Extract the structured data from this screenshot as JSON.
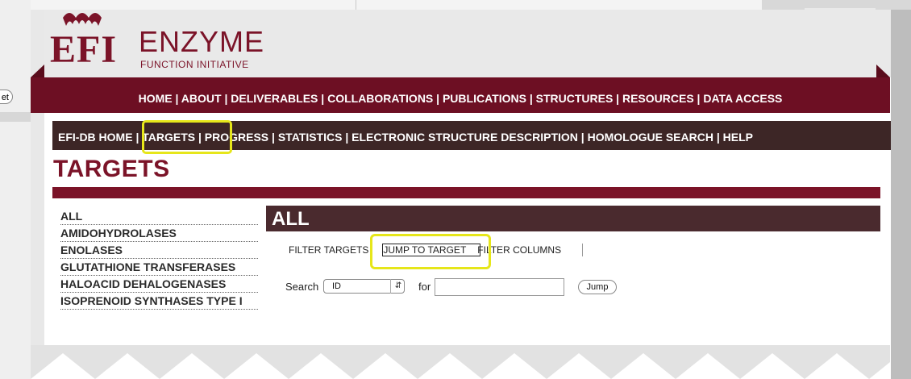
{
  "left_stub_button": "et",
  "logo": {
    "efi": "EFI",
    "name": "ENZYME",
    "subtitle": "FUNCTION INITIATIVE"
  },
  "main_nav": "HOME | ABOUT | DELIVERABLES | COLLABORATIONS | PUBLICATIONS | STRUCTURES | RESOURCES | DATA ACCESS",
  "sub_nav": "EFI-DB HOME | TARGETS | PROGRESS | STATISTICS | ELECTRONIC STRUCTURE DESCRIPTION | HOMOLOGUE SEARCH | HELP",
  "page_title": "TARGETS",
  "categories": [
    "ALL",
    "AMIDOHYDROLASES",
    "ENOLASES",
    "GLUTATHIONE TRANSFERASES",
    "HALOACID DEHALOGENASES",
    "ISOPRENOID SYNTHASES TYPE I"
  ],
  "panel": {
    "title": "ALL",
    "filter_targets": "FILTER TARGETS",
    "jump_to_target": "JUMP TO TARGET",
    "filter_columns": "FILTER COLUMNS",
    "search_label": "Search",
    "search_select_value": "ID",
    "for_label": "for",
    "search_input_value": "",
    "jump_button": "Jump"
  },
  "colors": {
    "brand_maroon": "#7b1328",
    "nav_dark": "#3d2626",
    "highlight": "#e6e61a"
  }
}
